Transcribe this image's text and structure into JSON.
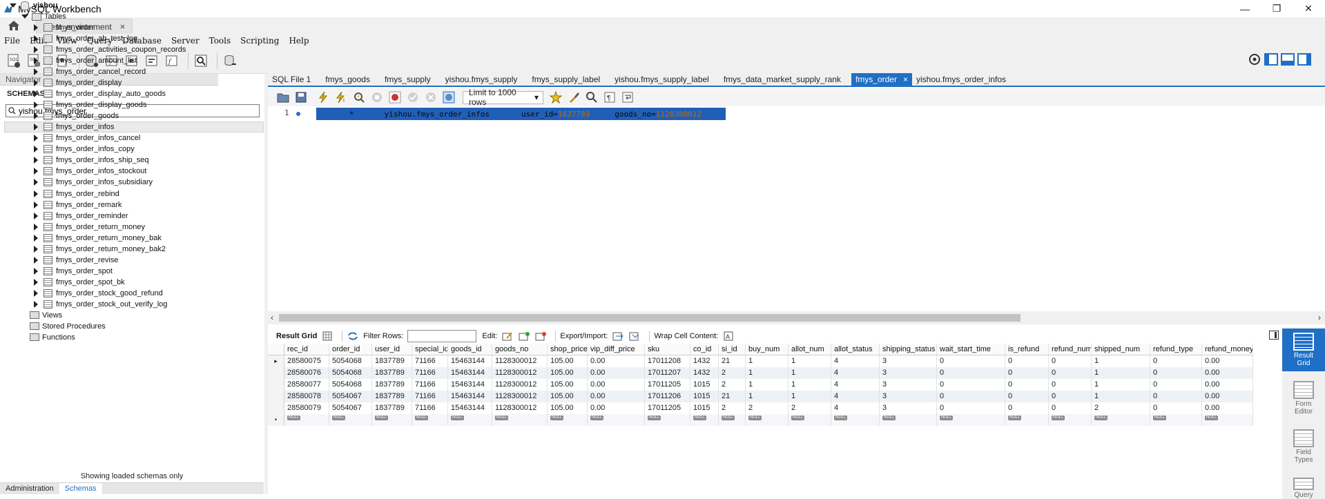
{
  "window": {
    "title": "MySQL Workbench",
    "minimize": "—",
    "restore": "❐",
    "close": "✕"
  },
  "connection_tab": {
    "label": "Test_environment",
    "close": "×"
  },
  "menu": [
    "File",
    "Edit",
    "View",
    "Query",
    "Database",
    "Server",
    "Tools",
    "Scripting",
    "Help"
  ],
  "navigator": {
    "header": "Navigator",
    "schemas_label": "SCHEMAS",
    "filter_value": "yishou.fmys_order",
    "schema": "yishou",
    "tables_label": "Tables",
    "tables": [
      "fmys_order",
      "fmys_order_ab_test_log",
      "fmys_order_activities_coupon_records",
      "fmys_order_amount_list",
      "fmys_order_cancel_record",
      "fmys_order_display",
      "fmys_order_display_auto_goods",
      "fmys_order_display_goods",
      "fmys_order_goods",
      "fmys_order_infos",
      "fmys_order_infos_cancel",
      "fmys_order_infos_copy",
      "fmys_order_infos_ship_seq",
      "fmys_order_infos_stockout",
      "fmys_order_infos_subsidiary",
      "fmys_order_rebind",
      "fmys_order_remark",
      "fmys_order_reminder",
      "fmys_order_return_money",
      "fmys_order_return_money_bak",
      "fmys_order_return_money_bak2",
      "fmys_order_revise",
      "fmys_order_spot",
      "fmys_order_spot_bk",
      "fmys_order_stock_good_refund",
      "fmys_order_stock_out_verify_log"
    ],
    "highlighted_index": 9,
    "views_label": "Views",
    "procs_label": "Stored Procedures",
    "funcs_label": "Functions",
    "note": "Showing loaded schemas only",
    "tab_admin": "Administration",
    "tab_schemas": "Schemas"
  },
  "editor_tabs": [
    "SQL File 1",
    "fmys_goods",
    "fmys_supply",
    "yishou.fmys_supply",
    "fmys_supply_label",
    "yishou.fmys_supply_label",
    "fmys_data_market_supply_rank",
    "fmys_order",
    "yishou.fmys_order_infos"
  ],
  "active_editor_tab": 7,
  "sql_toolbar": {
    "limit_label": "Limit to 1000 rows",
    "dropdown_arrow": "▾"
  },
  "editor": {
    "line_number": "1",
    "code_star": "*",
    "code_table": "yishou.fmys_order_infos",
    "code_user_key": "user_id=",
    "code_user_val": "1837789",
    "code_goods_key": "goods_no=",
    "code_goods_val": "1128300012"
  },
  "scroll": {
    "left": "‹",
    "right": "›"
  },
  "result_toolbar": {
    "result_grid": "Result Grid",
    "filter_rows": "Filter Rows:",
    "edit": "Edit:",
    "export_import": "Export/Import:",
    "wrap_cell": "Wrap Cell Content:"
  },
  "grid": {
    "columns": [
      "rec_id",
      "order_id",
      "user_id",
      "special_id",
      "goods_id",
      "goods_no",
      "shop_price",
      "vip_diff_price",
      "sku",
      "co_id",
      "si_id",
      "buy_num",
      "allot_num",
      "allot_status",
      "shipping_status",
      "wait_start_time",
      "is_refund",
      "refund_num",
      "shipped_num",
      "refund_type",
      "refund_money"
    ],
    "rows": [
      [
        "28580075",
        "5054068",
        "1837789",
        "71166",
        "15463144",
        "1128300012",
        "105.00",
        "0.00",
        "17011208",
        "1432",
        "21",
        "1",
        "1",
        "4",
        "3",
        "0",
        "0",
        "0",
        "1",
        "0",
        "0.00"
      ],
      [
        "28580076",
        "5054068",
        "1837789",
        "71166",
        "15463144",
        "1128300012",
        "105.00",
        "0.00",
        "17011207",
        "1432",
        "2",
        "1",
        "1",
        "4",
        "3",
        "0",
        "0",
        "0",
        "1",
        "0",
        "0.00"
      ],
      [
        "28580077",
        "5054068",
        "1837789",
        "71166",
        "15463144",
        "1128300012",
        "105.00",
        "0.00",
        "17011205",
        "1015",
        "2",
        "1",
        "1",
        "4",
        "3",
        "0",
        "0",
        "0",
        "1",
        "0",
        "0.00"
      ],
      [
        "28580078",
        "5054067",
        "1837789",
        "71166",
        "15463144",
        "1128300012",
        "105.00",
        "0.00",
        "17011206",
        "1015",
        "21",
        "1",
        "1",
        "4",
        "3",
        "0",
        "0",
        "0",
        "1",
        "0",
        "0.00"
      ],
      [
        "28580079",
        "5054067",
        "1837789",
        "71166",
        "15463144",
        "1128300012",
        "105.00",
        "0.00",
        "17011205",
        "1015",
        "2",
        "2",
        "2",
        "4",
        "3",
        "0",
        "0",
        "0",
        "2",
        "0",
        "0.00"
      ]
    ],
    "null_label": "NULL",
    "current_row_marker": "▸",
    "new_row_marker": "•"
  },
  "side_panel": {
    "result_grid": [
      "Result",
      "Grid"
    ],
    "form_editor": [
      "Form",
      "Editor"
    ],
    "field_types": [
      "Field",
      "Types"
    ],
    "query_stats": [
      "Query"
    ]
  },
  "colors": {
    "accent": "#1f6fc6",
    "selection": "#1f5fb8",
    "number_literal": "#b86a1a"
  }
}
